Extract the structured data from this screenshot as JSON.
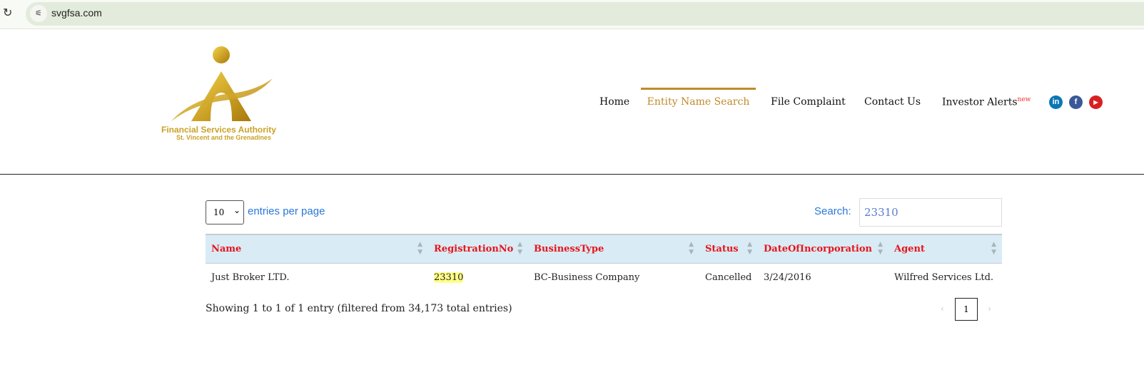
{
  "browser": {
    "url": "svgfsa.com"
  },
  "logo": {
    "line1": "Financial Services Authority",
    "line2": "St. Vincent and the Grenadines"
  },
  "nav": {
    "items": [
      "Home",
      "Entity Name Search",
      "File Complaint",
      "Contact Us",
      "Investor Alerts"
    ],
    "badge": "new",
    "active": "Entity Name Search"
  },
  "social": [
    "linkedin-icon",
    "facebook-icon",
    "youtube-icon"
  ],
  "controls": {
    "page_size": "10",
    "entries_label": "entries per page",
    "search_label": "Search:",
    "search_value": "23310"
  },
  "table": {
    "headers": [
      "Name",
      "RegistrationNo",
      "BusinessType",
      "Status",
      "DateOfIncorporation",
      "Agent"
    ],
    "rows": [
      [
        "Just Broker LTD.",
        "23310",
        "BC-Business Company",
        "Cancelled",
        "3/24/2016",
        "Wilfred Services Ltd."
      ]
    ]
  },
  "footer": {
    "info": "Showing 1 to 1 of 1 entry (filtered from 34,173 total entries)",
    "prev": "‹",
    "page": "1",
    "next": "›"
  },
  "colors": {
    "accent": "#c08a2a",
    "header_text": "#e8141c",
    "link": "#2a78d8"
  }
}
